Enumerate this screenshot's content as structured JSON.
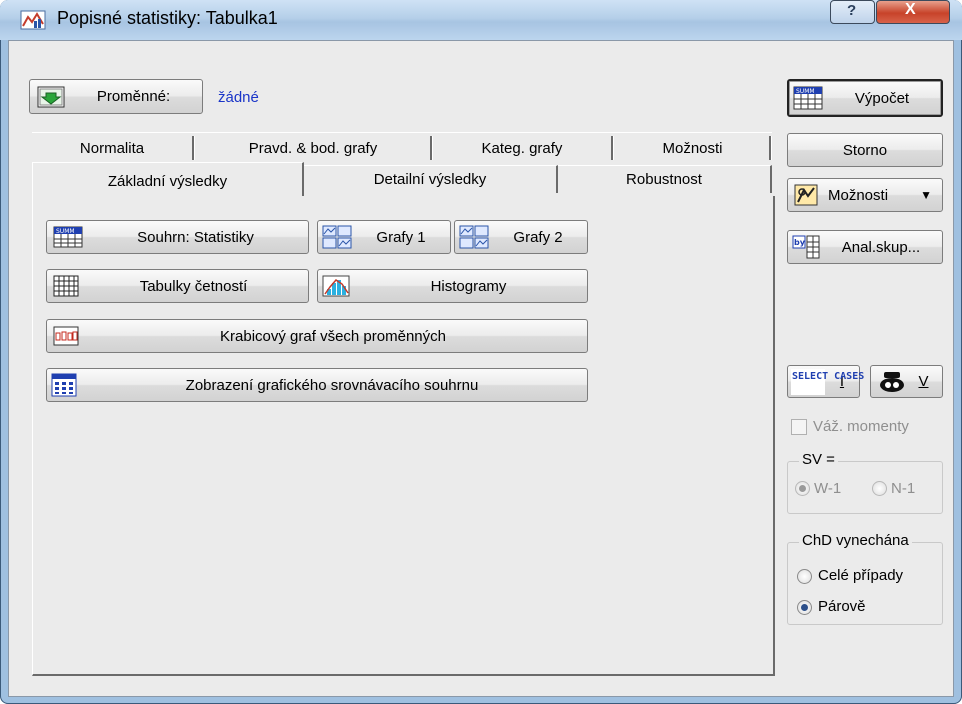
{
  "window": {
    "title": "Popisné statistiky: Tabulka1",
    "help_label": "?",
    "close_label": "X"
  },
  "variables": {
    "button_label": "Proměnné:",
    "value": "žádné"
  },
  "tabs_back": [
    "Normalita",
    "Pravd. & bod. grafy",
    "Kateg. grafy",
    "Možnosti"
  ],
  "tabs_front": [
    "Základní výsledky",
    "Detailní výsledky",
    "Robustnost"
  ],
  "panel": {
    "summary_stats": "Souhrn: Statistiky",
    "graphs1": "Grafy 1",
    "graphs2": "Grafy 2",
    "freq_tables": "Tabulky četností",
    "histograms": "Histogramy",
    "boxplot_all": "Krabicový graf všech proměnných",
    "summary_graph": "Zobrazení grafického srovnávacího souhrnu"
  },
  "side": {
    "compute": "Výpočet",
    "cancel": "Storno",
    "options": "Možnosti",
    "by_group": "Anal.skup...",
    "select_cases_icon_text": "SELECT CASES",
    "select_cases_label": "I",
    "weight_label": "V",
    "weighted_moments": "Váž. momenty",
    "df_group_label": "SV =",
    "df_w1": "W-1",
    "df_n1": "N-1",
    "md_group_label": "ChD vynechána",
    "md_casewise": "Celé případy",
    "md_pairwise": "Párově"
  },
  "state": {
    "weighted_moments": false,
    "df": "W-1",
    "missing_data": "Párově"
  }
}
